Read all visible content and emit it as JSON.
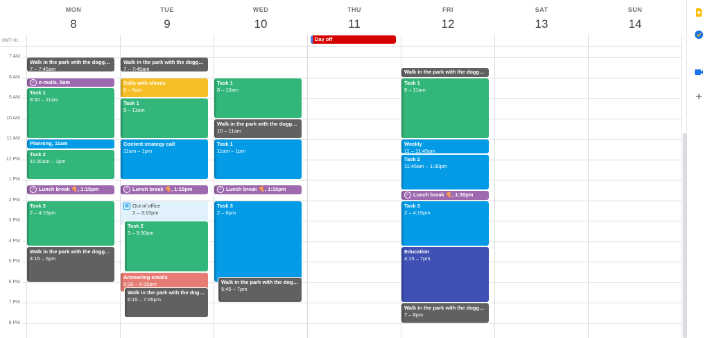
{
  "timezone": "GMT+01",
  "days": [
    {
      "dow": "MON",
      "num": "8"
    },
    {
      "dow": "TUE",
      "num": "9"
    },
    {
      "dow": "WED",
      "num": "10"
    },
    {
      "dow": "THU",
      "num": "11"
    },
    {
      "dow": "FRI",
      "num": "12"
    },
    {
      "dow": "SAT",
      "num": "13"
    },
    {
      "dow": "SUN",
      "num": "14"
    }
  ],
  "hours": [
    "7 AM",
    "8 AM",
    "9 AM",
    "10 AM",
    "11 AM",
    "12 PM",
    "1 PM",
    "2 PM",
    "3 PM",
    "4 PM",
    "5 PM",
    "6 PM",
    "7 PM",
    "8 PM"
  ],
  "all_day": [
    {
      "day": 3,
      "title": "Day off",
      "color": "#d50000"
    }
  ],
  "events": [
    {
      "day": 0,
      "start": 7,
      "end": 7.75,
      "title": "Walk in the park with the doggo 🐕",
      "time": "7 – 7:45am",
      "color": "#616161"
    },
    {
      "day": 0,
      "start": 8,
      "end": 8.5,
      "title": "e-mails, 8am",
      "time": "",
      "color": "#9e69af",
      "task": true
    },
    {
      "day": 0,
      "start": 8.5,
      "end": 11,
      "title": "Task 1",
      "time": "8:30 – 11am",
      "color": "#33b679"
    },
    {
      "day": 0,
      "start": 11,
      "end": 11.5,
      "title": "Planning, 11am",
      "time": "",
      "color": "#039be5"
    },
    {
      "day": 0,
      "start": 11.5,
      "end": 13,
      "title": "Task 2",
      "time": "11:30am – 1pm",
      "color": "#33b679"
    },
    {
      "day": 0,
      "start": 13.25,
      "end": 13.75,
      "title": "Lunch break 🍕, 1:15pm",
      "time": "",
      "color": "#9e69af",
      "task": true
    },
    {
      "day": 0,
      "start": 14,
      "end": 16.25,
      "title": "Task 3",
      "time": "2 – 4:15pm",
      "color": "#33b679"
    },
    {
      "day": 0,
      "start": 16.25,
      "end": 18,
      "title": "Walk in the park with the doggo 🐕",
      "time": "4:15 – 6pm",
      "color": "#616161"
    },
    {
      "day": 1,
      "start": 7,
      "end": 7.75,
      "title": "Walk in the park with the doggo 🐕",
      "time": "7 – 7:45am",
      "color": "#616161"
    },
    {
      "day": 1,
      "start": 8,
      "end": 9,
      "title": "Calls with clients",
      "time": "8 – 9am",
      "color": "#f6bf26"
    },
    {
      "day": 1,
      "start": 9,
      "end": 11,
      "title": "Task 1",
      "time": "9 – 11am",
      "color": "#33b679"
    },
    {
      "day": 1,
      "start": 11,
      "end": 13,
      "title": "Content strategy call",
      "time": "11am – 1pm",
      "color": "#039be5"
    },
    {
      "day": 1,
      "start": 13.25,
      "end": 13.75,
      "title": "Lunch break 🍕, 1:15pm",
      "time": "",
      "color": "#9e69af",
      "task": true
    },
    {
      "day": 1,
      "start": 14,
      "end": 15.25,
      "title": "Out of office",
      "time": "2 – 3:15pm",
      "color": "#e1f1fb",
      "text": "#3c4043",
      "ooo": true
    },
    {
      "day": 1,
      "start": 15,
      "end": 17.5,
      "title": "Task 2",
      "time": "3 – 5:30pm",
      "color": "#33b679",
      "indent": 6
    },
    {
      "day": 1,
      "start": 17.5,
      "end": 18.5,
      "title": "Answering emails",
      "time": "5:30 – 6:30pm",
      "color": "#e67c73"
    },
    {
      "day": 1,
      "start": 18.25,
      "end": 19.75,
      "title": "Walk in the park with the doggo 🐕",
      "time": "6:15 – 7:45pm",
      "color": "#616161",
      "indent": 6
    },
    {
      "day": 2,
      "start": 8,
      "end": 10,
      "title": "Task 1",
      "time": "8 – 10am",
      "color": "#33b679"
    },
    {
      "day": 2,
      "start": 10,
      "end": 11,
      "title": "Walk in the park with the doggo 🐕",
      "time": "10 – 11am",
      "color": "#616161"
    },
    {
      "day": 2,
      "start": 11,
      "end": 13,
      "title": "Task 1",
      "time": "11am – 1pm",
      "color": "#039be5"
    },
    {
      "day": 2,
      "start": 13.25,
      "end": 13.75,
      "title": "Lunch break 🍕, 1:15pm",
      "time": "",
      "color": "#9e69af",
      "task": true
    },
    {
      "day": 2,
      "start": 14,
      "end": 18,
      "title": "Task 3",
      "time": "2 – 6pm",
      "color": "#039be5"
    },
    {
      "day": 2,
      "start": 17.75,
      "end": 19,
      "title": "Walk in the park with the doggo 🐕",
      "time": "5:45 – 7pm",
      "color": "#616161",
      "indent": 6
    },
    {
      "day": 4,
      "start": 7.5,
      "end": 8,
      "title": "Walk in the park with the doggo 🐕, 7:30am",
      "time": "",
      "color": "#616161"
    },
    {
      "day": 4,
      "start": 8,
      "end": 11,
      "title": "Task 1",
      "time": "8 – 11am",
      "color": "#33b679"
    },
    {
      "day": 4,
      "start": 11,
      "end": 11.75,
      "title": "Weekly",
      "time": "11 – 11:45am",
      "color": "#039be5"
    },
    {
      "day": 4,
      "start": 11.75,
      "end": 13.5,
      "title": "Task 2",
      "time": "11:45am – 1:30pm",
      "color": "#039be5"
    },
    {
      "day": 4,
      "start": 13.5,
      "end": 14,
      "title": "Lunch break 🍕, 1:30pm",
      "time": "",
      "color": "#9e69af",
      "task": true
    },
    {
      "day": 4,
      "start": 14,
      "end": 16.25,
      "title": "Task 3",
      "time": "2 – 4:15pm",
      "color": "#039be5"
    },
    {
      "day": 4,
      "start": 16.25,
      "end": 19,
      "title": "Education",
      "time": "4:15 – 7pm",
      "color": "#3f51b5"
    },
    {
      "day": 4,
      "start": 19,
      "end": 20,
      "title": "Walk in the park with the doggo 🐕",
      "time": "7 – 8pm",
      "color": "#616161"
    }
  ],
  "side_icons": [
    {
      "name": "keep-icon",
      "color": "#fbbc04"
    },
    {
      "name": "tasks-icon",
      "color": "#1a73e8"
    },
    {
      "name": "meet-icon",
      "color": "#1a73e8"
    },
    {
      "name": "add-icon",
      "color": "#5f6368"
    }
  ]
}
